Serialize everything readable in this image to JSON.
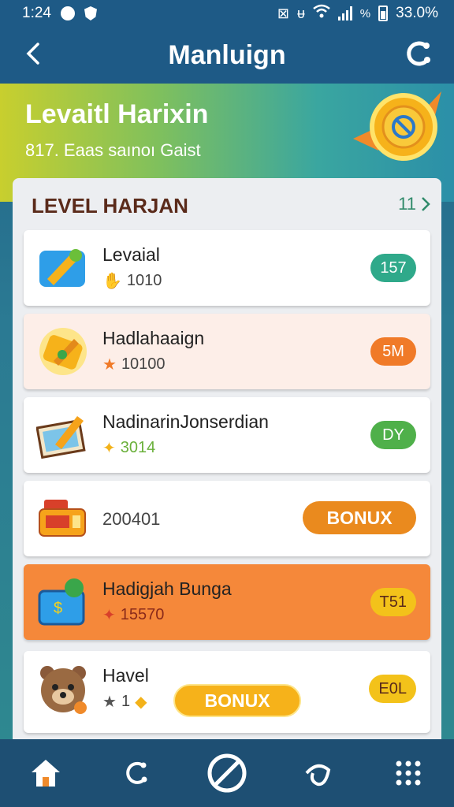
{
  "status": {
    "time": "1:24",
    "battery": "33.0%",
    "percent_symbol": "%"
  },
  "header": {
    "title": "Manluign"
  },
  "hero": {
    "title": "Levaitl Harixin",
    "subtitle": "817. Eaas saınoı Gaist"
  },
  "section": {
    "title": "LEVEL HARJAN",
    "count": "11"
  },
  "rows": [
    {
      "title": "Levaial",
      "meta": "1010",
      "badge": "157",
      "badge_color": "#2fa98a",
      "bg": "#ffffff"
    },
    {
      "title": "Hadlahaaign",
      "meta": "10100",
      "badge": "5M",
      "badge_color": "#f07a28",
      "bg": "#fdeee8"
    },
    {
      "title": "NadinarinJonserdian",
      "meta": "3014",
      "badge": "DY",
      "badge_color": "#4fb04a",
      "bg": "#ffffff"
    },
    {
      "title": "",
      "meta": "200401",
      "badge": "BONUX",
      "badge_color": "#ea8a1e",
      "bg": "#ffffff"
    },
    {
      "title": "Hadigjah Bunga",
      "meta": "15570",
      "badge": "T51",
      "badge_color": "#f3c21a",
      "bg": "#f5883a"
    },
    {
      "title": "Havel",
      "meta": "1",
      "badge": "E0L",
      "badge_color": "#f3c21a",
      "bg": "#ffffff",
      "bonus": "BONUX"
    }
  ],
  "nav": {
    "items": [
      "home-icon",
      "link-icon",
      "prohibited-icon",
      "loop-icon",
      "grid-icon"
    ]
  }
}
